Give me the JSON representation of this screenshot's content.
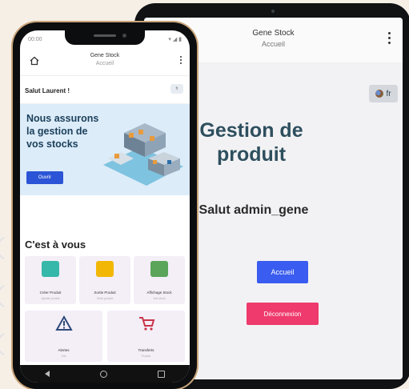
{
  "tablet": {
    "app_title": "Gene Stock",
    "app_subtitle": "Accueil",
    "lang_label": "fr",
    "heading": "Gestion de produit",
    "greeting": "Salut  admin_gene",
    "accueil_button": "Accueil",
    "logout_button": "Déconnexion"
  },
  "phone": {
    "status_left": "00:00",
    "status_right": "▾ ◢ ▮",
    "app_title": "Gene Stock",
    "app_subtitle": "Accueil",
    "greeting": "Salut  Laurent !",
    "flag_label": "fr",
    "banner_text": "Nous assurons la gestion de vos stocks",
    "banner_button": "Ouvrir",
    "section_title": "C'est à vous",
    "cards_row1": [
      {
        "label": "Créer Produit",
        "sub": "Ajouter produit",
        "icon": "monitor-icon",
        "color": "#35b7a9"
      },
      {
        "label": "Sortie Produit",
        "sub": "Sortir produit",
        "icon": "truck-icon",
        "color": "#f2b705"
      },
      {
        "label": "Affichage Stock",
        "sub": "Voir stock",
        "icon": "screen-icon",
        "color": "#5aa55a"
      }
    ],
    "cards_row2": [
      {
        "label": "Alertes",
        "sub": "Voir",
        "icon": "warning-icon",
        "color": "#2f4a7a"
      },
      {
        "label": "Transferts",
        "sub": "Produit",
        "icon": "cart-icon",
        "color": "#c8334a"
      }
    ]
  }
}
